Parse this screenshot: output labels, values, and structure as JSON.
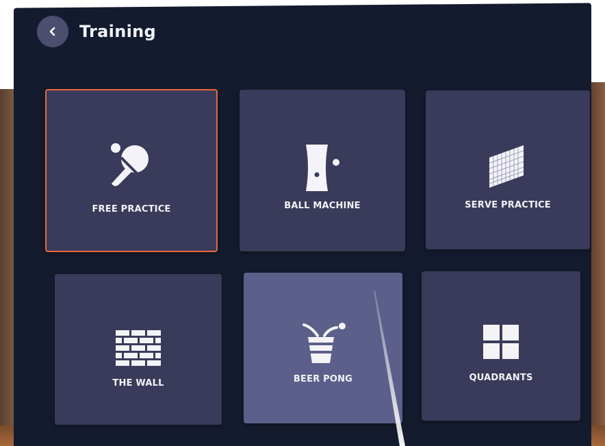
{
  "header": {
    "title": "Training",
    "back_icon": "chevron-left-icon"
  },
  "tiles": [
    {
      "label": "FREE PRACTICE",
      "icon": "paddle-ball-icon",
      "selected": true
    },
    {
      "label": "BALL MACHINE",
      "icon": "ball-machine-icon"
    },
    {
      "label": "SERVE PRACTICE",
      "icon": "net-icon"
    },
    {
      "label": "THE WALL",
      "icon": "brick-wall-icon"
    },
    {
      "label": "BEER PONG",
      "icon": "cup-bounce-icon",
      "hovered": true
    },
    {
      "label": "QUADRANTS",
      "icon": "quadrants-icon"
    }
  ],
  "colors": {
    "panel": "#141b2e",
    "tile": "#3a3b5a",
    "tile_hover": "#5c5f8a",
    "selected_border": "#e8693a",
    "text": "#f2f2f6"
  }
}
